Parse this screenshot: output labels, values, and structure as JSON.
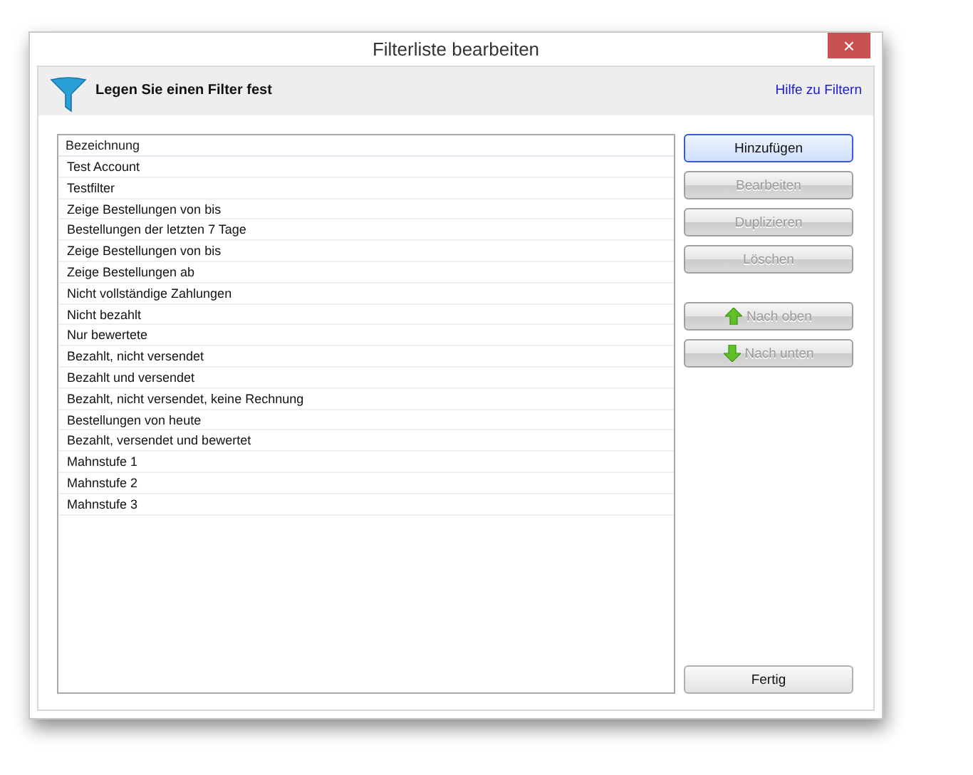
{
  "window": {
    "title": "Filterliste bearbeiten",
    "close": "×"
  },
  "header": {
    "title": "Legen Sie einen Filter fest",
    "help_link": "Hilfe zu Filtern"
  },
  "list": {
    "column": "Bezeichnung",
    "rows": [
      {
        "label": "Test Account"
      },
      {
        "label": "Testfilter"
      },
      {
        "label": "Zeige Bestellungen von bis"
      },
      {
        "label": "Bestellungen der letzten 7 Tage"
      },
      {
        "label": "Zeige Bestellungen von bis"
      },
      {
        "label": "Zeige Bestellungen ab"
      },
      {
        "label": "Nicht vollständige Zahlungen"
      },
      {
        "label": "Nicht bezahlt"
      },
      {
        "label": "Nur bewertete"
      },
      {
        "label": "Bezahlt, nicht versendet"
      },
      {
        "label": "Bezahlt und versendet"
      },
      {
        "label": "Bezahlt, nicht versendet, keine Rechnung"
      },
      {
        "label": "Bestellungen von heute"
      },
      {
        "label": "Bezahlt, versendet und bewertet"
      },
      {
        "label": "Mahnstufe 1"
      },
      {
        "label": "Mahnstufe 2"
      },
      {
        "label": "Mahnstufe 3"
      }
    ]
  },
  "buttons": [
    {
      "label": "Hinzufügen",
      "kind": "plain",
      "default": true,
      "disabled": false
    },
    {
      "label": "Bearbeiten",
      "kind": "plain",
      "default": false,
      "disabled": true
    },
    {
      "label": "Duplizieren",
      "kind": "plain",
      "default": false,
      "disabled": true
    },
    {
      "label": "Löschen",
      "kind": "plain",
      "default": false,
      "disabled": true
    },
    {
      "label": "Nach oben",
      "kind": "up",
      "default": false,
      "disabled": true
    },
    {
      "label": "Nach unten",
      "kind": "down",
      "default": false,
      "disabled": true
    }
  ],
  "done_button": {
    "label": "Fertig"
  }
}
